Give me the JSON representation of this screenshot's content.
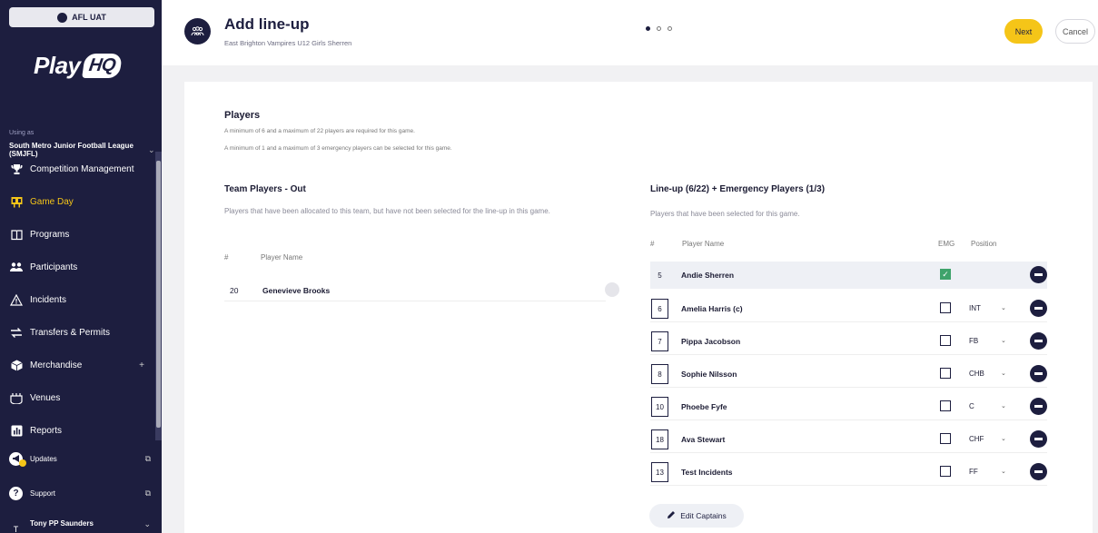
{
  "env": {
    "label": "AFL UAT"
  },
  "brand": {
    "name": "Play",
    "badge": "HQ"
  },
  "account": {
    "using_label": "Using as",
    "org": "South Metro Junior Football League (SMJFL)"
  },
  "nav": [
    {
      "label": "Competition Management",
      "icon": "trophy-icon",
      "active": false
    },
    {
      "label": "Game Day",
      "icon": "scoreboard-icon",
      "active": true
    },
    {
      "label": "Programs",
      "icon": "book-icon",
      "active": false
    },
    {
      "label": "Participants",
      "icon": "people-icon",
      "active": false
    },
    {
      "label": "Incidents",
      "icon": "warning-icon",
      "active": false
    },
    {
      "label": "Transfers & Permits",
      "icon": "swap-icon",
      "active": false
    },
    {
      "label": "Merchandise",
      "icon": "box-icon",
      "active": false
    },
    {
      "label": "Venues",
      "icon": "stadium-icon",
      "active": false
    },
    {
      "label": "Reports",
      "icon": "chart-icon",
      "active": false
    }
  ],
  "bottom": {
    "updates": "Updates",
    "support": "Support",
    "user": "Tony PP Saunders",
    "user_initial": "T"
  },
  "header": {
    "title": "Add line-up",
    "subtitle": "East Brighton Vampires U12 Girls Sherren",
    "next": "Next",
    "cancel": "Cancel",
    "steps": 3,
    "current_step": 1
  },
  "players": {
    "title": "Players",
    "rule1": "A minimum of 6 and a maximum of 22 players are required for this game.",
    "rule2": "A minimum of 1 and a maximum of 3 emergency players can be selected for this game."
  },
  "out": {
    "title": "Team Players - Out",
    "desc": "Players that have been allocated to this team, but have not been selected for the line-up in this game.",
    "col_num": "#",
    "col_name": "Player Name",
    "rows": [
      {
        "num": "20",
        "name": "Genevieve Brooks"
      }
    ]
  },
  "lineup": {
    "title": "Line-up (6/22) + Emergency Players (1/3)",
    "desc": "Players that have been selected for this game.",
    "col_num": "#",
    "col_name": "Player Name",
    "col_emg": "EMG",
    "col_pos": "Position",
    "rows": [
      {
        "num": "5",
        "name": "Andie Sherren",
        "emg": true,
        "pos": ""
      },
      {
        "num": "6",
        "name": "Amelia Harris (c)",
        "emg": false,
        "pos": "INT"
      },
      {
        "num": "7",
        "name": "Pippa Jacobson",
        "emg": false,
        "pos": "FB"
      },
      {
        "num": "8",
        "name": "Sophie Nilsson",
        "emg": false,
        "pos": "CHB"
      },
      {
        "num": "10",
        "name": "Phoebe Fyfe",
        "emg": false,
        "pos": "C"
      },
      {
        "num": "18",
        "name": "Ava Stewart",
        "emg": false,
        "pos": "CHF"
      },
      {
        "num": "13",
        "name": "Test Incidents",
        "emg": false,
        "pos": "FF"
      }
    ],
    "edit_captains": "Edit Captains"
  },
  "colors": {
    "navy": "#1d1e3f",
    "accent": "#f5c518",
    "check": "#3fa36b"
  }
}
